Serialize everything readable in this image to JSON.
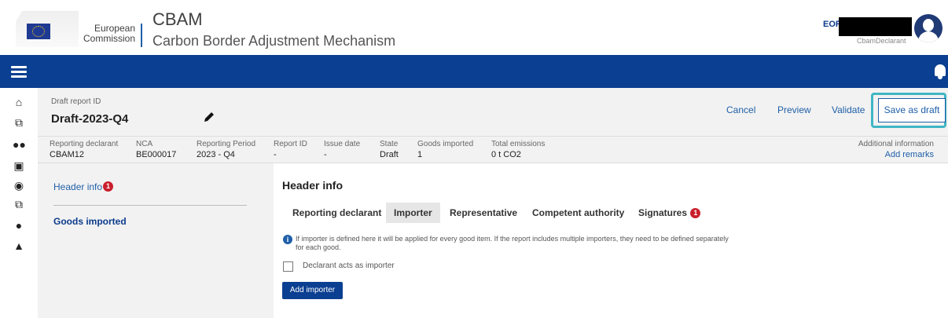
{
  "header": {
    "org_line1": "European",
    "org_line2": "Commission",
    "app_title": "CBAM",
    "app_subtitle": "Carbon Border Adjustment Mechanism",
    "eori_label": "EORI",
    "user_role": "CbamDeclarant"
  },
  "report": {
    "id_label": "Draft report ID",
    "id_value": "Draft-2023-Q4"
  },
  "actions": {
    "cancel": "Cancel",
    "preview": "Preview",
    "validate": "Validate",
    "save_draft": "Save as draft"
  },
  "info_strip": [
    {
      "label": "Reporting declarant",
      "value": "CBAM12"
    },
    {
      "label": "NCA",
      "value": "BE000017"
    },
    {
      "label": "Reporting Period",
      "value": "2023 - Q4"
    },
    {
      "label": "Report ID",
      "value": "-"
    },
    {
      "label": "Issue date",
      "value": "-"
    },
    {
      "label": "State",
      "value": "Draft"
    },
    {
      "label": "Goods imported",
      "value": "1"
    },
    {
      "label": "Total emissions",
      "value": "0 t CO2"
    }
  ],
  "additional": {
    "label": "Additional information",
    "link": "Add remarks"
  },
  "left_nav": {
    "item1": "Header info",
    "item1_badge": "1",
    "item2": "Goods imported"
  },
  "main": {
    "title": "Header info",
    "tabs": [
      {
        "label": "Reporting declarant"
      },
      {
        "label": "Importer"
      },
      {
        "label": "Representative"
      },
      {
        "label": "Competent authority"
      },
      {
        "label": "Signatures",
        "badge": "1"
      }
    ],
    "info_text": "If importer is defined here it will be applied for every good item. If the report includes multiple importers, they need to be defined separately for each good.",
    "checkbox_label": "Declarant acts as importer",
    "add_button": "Add importer"
  }
}
